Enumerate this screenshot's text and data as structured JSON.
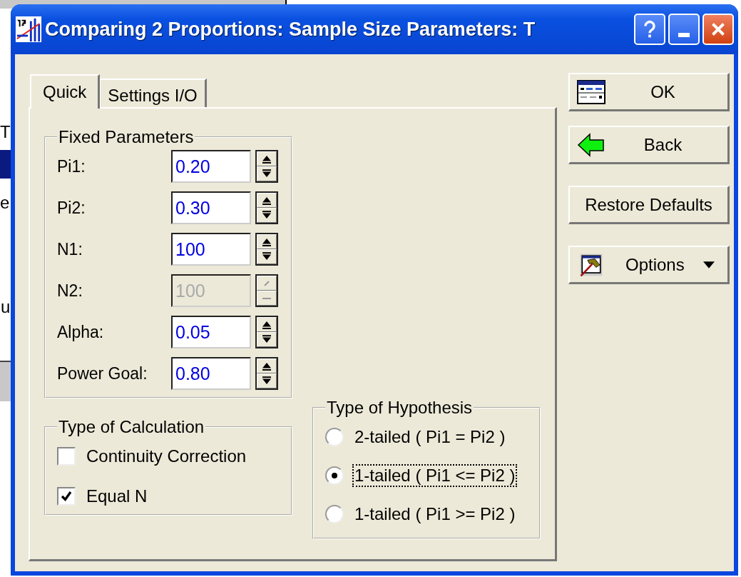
{
  "background_window": {
    "texts": [
      "T",
      "e",
      "u"
    ]
  },
  "window": {
    "title": "Comparing 2 Proportions: Sample Size Parameters: T"
  },
  "tabs": [
    {
      "label": "Quick",
      "selected": true
    },
    {
      "label": "Settings I/O",
      "selected": false
    }
  ],
  "fixed_parameters": {
    "title": "Fixed Parameters",
    "fields": [
      {
        "label": "Pi1:",
        "value": "0.20",
        "disabled": false
      },
      {
        "label": "Pi2:",
        "value": "0.30",
        "disabled": false
      },
      {
        "label": "N1:",
        "value": "100",
        "disabled": false
      },
      {
        "label": "N2:",
        "value": "100",
        "disabled": true
      },
      {
        "label": "Alpha:",
        "value": "0.05",
        "disabled": false
      },
      {
        "label": "Power Goal:",
        "value": "0.80",
        "disabled": false
      }
    ]
  },
  "type_of_calculation": {
    "title": "Type of Calculation",
    "options": [
      {
        "label": "Continuity Correction",
        "checked": false
      },
      {
        "label": "Equal N",
        "checked": true
      }
    ]
  },
  "type_of_hypothesis": {
    "title": "Type of Hypothesis",
    "options": [
      {
        "label": "2-tailed ( Pi1 = Pi2 )",
        "selected": false
      },
      {
        "label": "1-tailed ( Pi1 <= Pi2 )",
        "selected": true
      },
      {
        "label": "1-tailed ( Pi1 >= Pi2 )",
        "selected": false
      }
    ]
  },
  "buttons": [
    {
      "kind": "ok",
      "label": "OK"
    },
    {
      "kind": "back",
      "label": "Back"
    },
    {
      "kind": "plain",
      "label": "Restore Defaults"
    },
    {
      "kind": "options",
      "label": "Options"
    }
  ]
}
